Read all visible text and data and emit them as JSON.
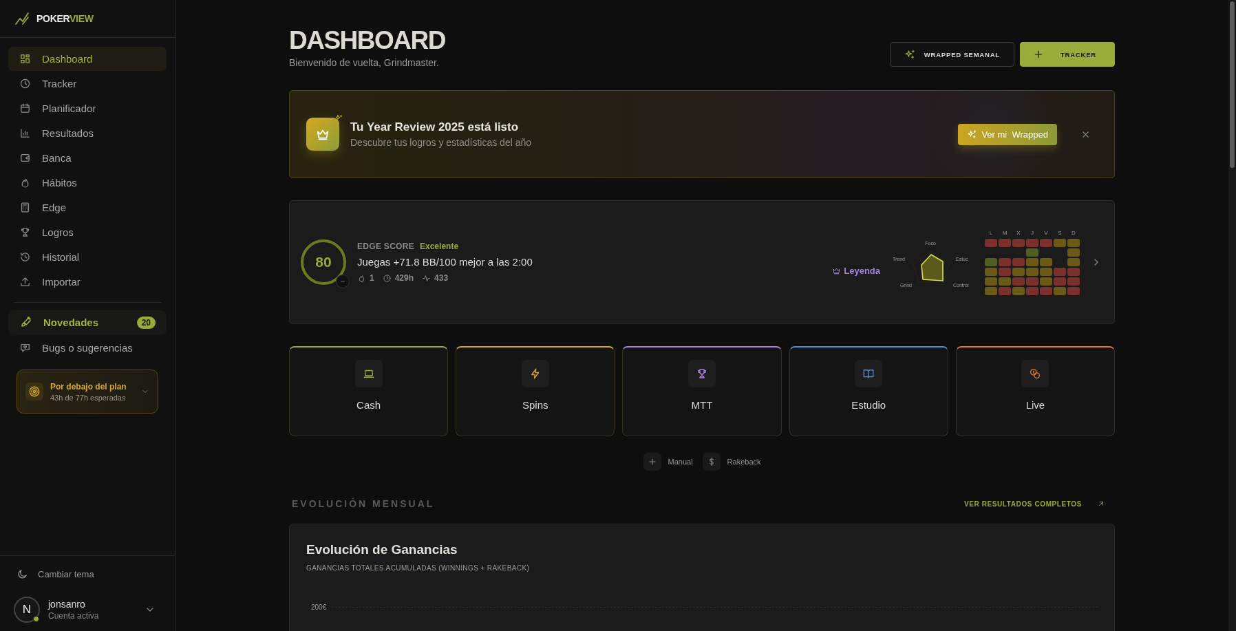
{
  "brand": {
    "part_1": "POKER",
    "part_2": "VIEW"
  },
  "nav": [
    {
      "label": "Dashboard",
      "selected": true
    },
    {
      "label": "Tracker",
      "selected": false
    },
    {
      "label": "Planificador",
      "selected": false
    },
    {
      "label": "Resultados",
      "selected": false
    },
    {
      "label": "Banca",
      "selected": false
    },
    {
      "label": "Hábitos",
      "selected": false
    },
    {
      "label": "Edge",
      "selected": false
    },
    {
      "label": "Logros",
      "selected": false
    },
    {
      "label": "Historial",
      "selected": false
    },
    {
      "label": "Importar",
      "selected": false
    }
  ],
  "news": {
    "label": "Novedades",
    "count": "20"
  },
  "feedback": {
    "label": "Bugs o sugerencias"
  },
  "plan_card": {
    "title": "Por debajo del plan",
    "subtitle": "43h de 77h esperadas"
  },
  "theme_toggle": {
    "label": "Cambiar tema"
  },
  "user": {
    "initial": "N",
    "name": "jonsanro",
    "status": "Cuenta activa"
  },
  "header": {
    "title": "DASHBOARD",
    "subtitle": "Bienvenido de vuelta, Grindmaster.",
    "buttons": [
      {
        "label": "WRAPPED SEMANAL",
        "kind": "outline"
      },
      {
        "label": "TRACKER",
        "kind": "primary"
      }
    ]
  },
  "banner": {
    "title": "Tu Year Review 2025 está listo",
    "subtitle": "Descubre tus logros y estadísticas del año",
    "button": "Ver mi  Wrapped"
  },
  "edge": {
    "score": "80",
    "label": "EDGE SCORE",
    "rating": "Excelente",
    "insight": "Juegas +71.8 BB/100 mejor a las 2:00",
    "stats": [
      "1",
      "429h",
      "433"
    ],
    "rank": "Leyenda",
    "radar_labels": [
      "Foco",
      "Estuc",
      "Control",
      "Grind",
      "Trend"
    ],
    "days": [
      "L",
      "M",
      "X",
      "J",
      "V",
      "S",
      "D"
    ],
    "heatmap": [
      {
        "cells": [
          {
            "kind": "filled",
            "color": "#7a302c"
          },
          {
            "kind": "filled",
            "color": "#7a302c"
          },
          {
            "kind": "filled",
            "color": "#7a302c"
          },
          {
            "kind": "filled",
            "color": "#7a302c"
          },
          {
            "kind": "filled",
            "color": "#7a302c"
          },
          {
            "kind": "filled",
            "color": "#6b5a16"
          },
          {
            "kind": "filled",
            "color": "#6b5a16"
          }
        ]
      },
      {
        "cells": [
          {
            "kind": "empty"
          },
          {
            "kind": "empty"
          },
          {
            "kind": "empty"
          },
          {
            "kind": "filled",
            "color": "#505e22"
          },
          {
            "kind": "empty"
          },
          {
            "kind": "empty"
          },
          {
            "kind": "filled",
            "color": "#6b5a16"
          }
        ]
      },
      {
        "cells": [
          {
            "kind": "filled",
            "color": "#505e22"
          },
          {
            "kind": "filled",
            "color": "#7a302c"
          },
          {
            "kind": "filled",
            "color": "#7a302c"
          },
          {
            "kind": "filled",
            "color": "#6b5a16"
          },
          {
            "kind": "filled",
            "color": "#6b5a16"
          },
          {
            "kind": "empty"
          },
          {
            "kind": "filled",
            "color": "#6b5a16"
          }
        ]
      },
      {
        "cells": [
          {
            "kind": "filled",
            "color": "#6b5a16"
          },
          {
            "kind": "filled",
            "color": "#7a302c"
          },
          {
            "kind": "filled",
            "color": "#6b5a16"
          },
          {
            "kind": "filled",
            "color": "#6b5a16"
          },
          {
            "kind": "filled",
            "color": "#6b5a16"
          },
          {
            "kind": "filled",
            "color": "#7a302c"
          },
          {
            "kind": "filled",
            "color": "#7a302c"
          }
        ]
      },
      {
        "cells": [
          {
            "kind": "filled",
            "color": "#6b5a16"
          },
          {
            "kind": "filled",
            "color": "#6b5a16"
          },
          {
            "kind": "filled",
            "color": "#7a302c"
          },
          {
            "kind": "filled",
            "color": "#7a302c"
          },
          {
            "kind": "filled",
            "color": "#6b5a16"
          },
          {
            "kind": "filled",
            "color": "#7a302c"
          },
          {
            "kind": "filled",
            "color": "#7a302c"
          }
        ]
      },
      {
        "cells": [
          {
            "kind": "filled",
            "color": "#6b5a16"
          },
          {
            "kind": "filled",
            "color": "#7a302c"
          },
          {
            "kind": "filled",
            "color": "#6b5a16"
          },
          {
            "kind": "filled",
            "color": "#7a302c"
          },
          {
            "kind": "filled",
            "color": "#7a302c"
          },
          {
            "kind": "filled",
            "color": "#6b5a16"
          },
          {
            "kind": "filled",
            "color": "#7a302c"
          }
        ]
      }
    ]
  },
  "categories": [
    {
      "label": "Cash",
      "color": "#9aab34"
    },
    {
      "label": "Spins",
      "color": "#d4a62a"
    },
    {
      "label": "MTT",
      "color": "#a483dc"
    },
    {
      "label": "Estudio",
      "color": "#4a90d0"
    },
    {
      "label": "Live",
      "color": "#e07a2c"
    }
  ],
  "quick_actions": [
    "Manual",
    "Rakeback"
  ],
  "section": {
    "title": "EVOLUCIÓN MENSUAL",
    "link": "VER RESULTADOS COMPLETOS"
  },
  "chart_card": {
    "title": "Evolución de Ganancias",
    "subtitle": "GANANCIAS TOTALES ACUMULADAS (WINNINGS + RAKEBACK)",
    "y_tick_labels": [
      "200€"
    ]
  }
}
